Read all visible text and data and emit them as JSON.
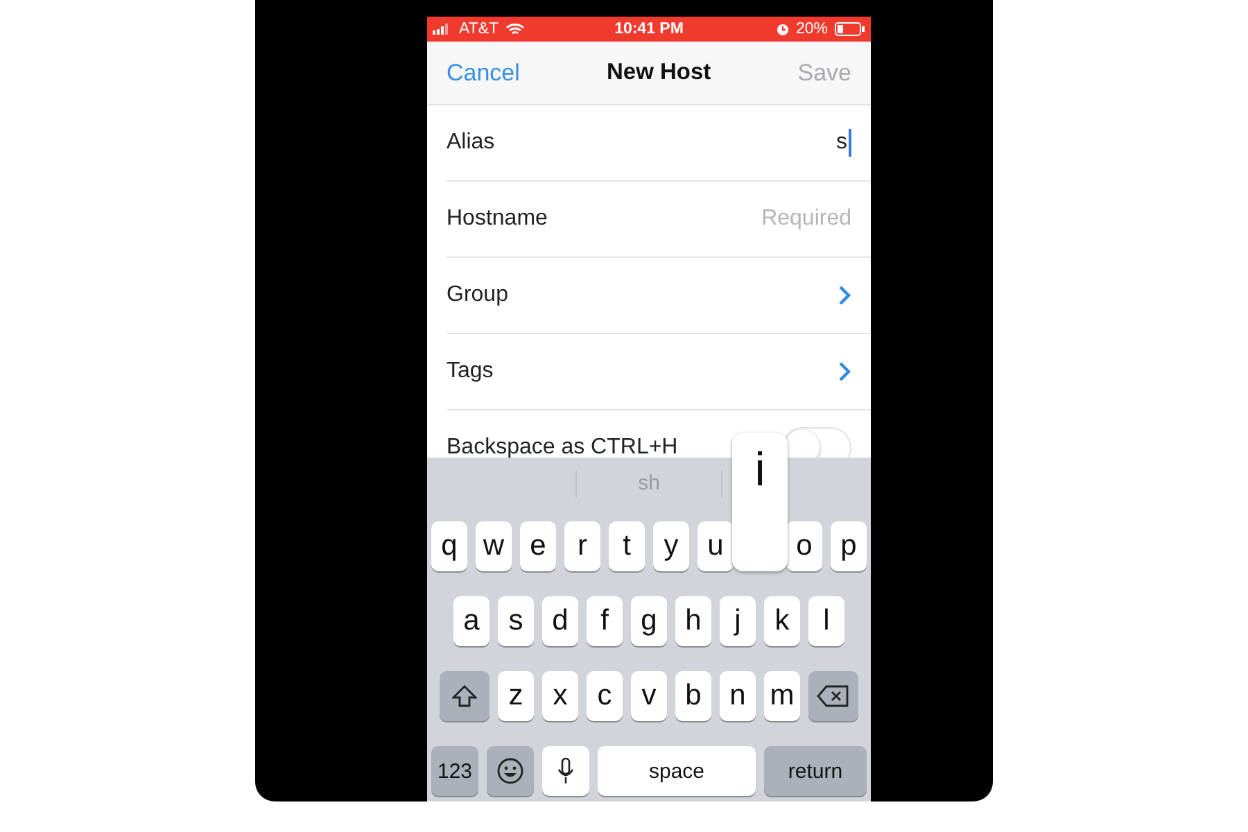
{
  "status_bar": {
    "carrier": "AT&T",
    "time": "10:41 PM",
    "battery": "20%"
  },
  "nav": {
    "cancel": "Cancel",
    "title": "New Host",
    "save": {
      "label": "Save",
      "disabled": true
    }
  },
  "rows": [
    {
      "kind": "field",
      "label": "Alias",
      "value": "s",
      "focused": true
    },
    {
      "kind": "field",
      "label": "Hostname",
      "placeholder": "Required",
      "focused": false
    },
    {
      "kind": "link",
      "label": "Group"
    },
    {
      "kind": "link",
      "label": "Tags"
    },
    {
      "kind": "toggle",
      "label": "Backspace as CTRL+H",
      "on": false
    }
  ],
  "keyboard": {
    "suggestions": [
      "sh"
    ],
    "rows": [
      [
        {
          "kind": "char",
          "label": "q"
        },
        {
          "kind": "char",
          "label": "w"
        },
        {
          "kind": "char",
          "label": "e"
        },
        {
          "kind": "char",
          "label": "r"
        },
        {
          "kind": "char",
          "label": "t"
        },
        {
          "kind": "char",
          "label": "y"
        },
        {
          "kind": "char",
          "label": "u"
        },
        {
          "kind": "char",
          "label": "i",
          "pressed": true
        },
        {
          "kind": "char",
          "label": "o"
        },
        {
          "kind": "char",
          "label": "p"
        }
      ],
      [
        {
          "kind": "char",
          "label": "a"
        },
        {
          "kind": "char",
          "label": "s"
        },
        {
          "kind": "char",
          "label": "d"
        },
        {
          "kind": "char",
          "label": "f"
        },
        {
          "kind": "char",
          "label": "g"
        },
        {
          "kind": "char",
          "label": "h"
        },
        {
          "kind": "char",
          "label": "j"
        },
        {
          "kind": "char",
          "label": "k"
        },
        {
          "kind": "char",
          "label": "l"
        }
      ],
      [
        {
          "kind": "shift"
        },
        {
          "kind": "char",
          "label": "z"
        },
        {
          "kind": "char",
          "label": "x"
        },
        {
          "kind": "char",
          "label": "c"
        },
        {
          "kind": "char",
          "label": "v"
        },
        {
          "kind": "char",
          "label": "b"
        },
        {
          "kind": "char",
          "label": "n"
        },
        {
          "kind": "char",
          "label": "m"
        },
        {
          "kind": "delete"
        }
      ]
    ],
    "bottom_row": [
      {
        "kind": "mode",
        "label": "123"
      },
      {
        "kind": "emoji"
      },
      {
        "kind": "mic"
      },
      {
        "kind": "space",
        "label": "space"
      },
      {
        "kind": "return",
        "label": "return"
      }
    ]
  }
}
